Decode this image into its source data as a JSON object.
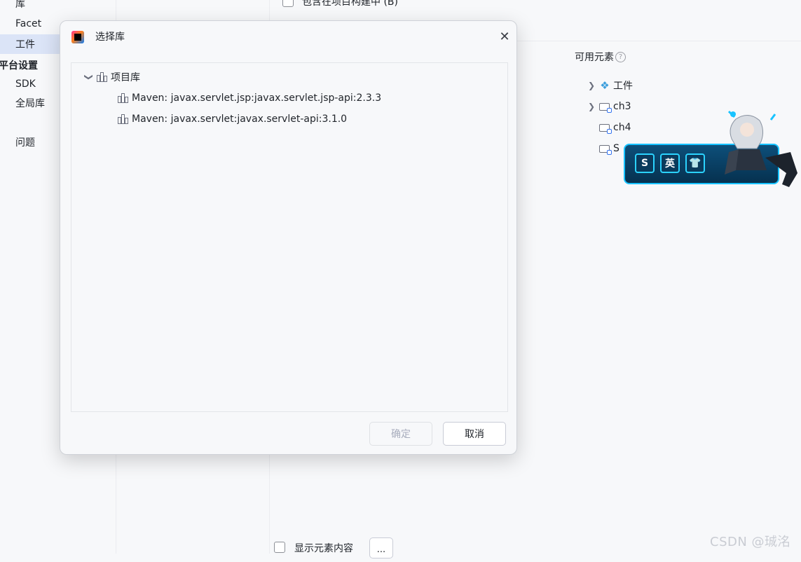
{
  "left_nav": {
    "items_top": [
      "库",
      "Facet",
      "工件"
    ],
    "section_header": "平台设置",
    "items_platform": [
      "SDK",
      "全局库"
    ],
    "problems": "问题"
  },
  "right_pane": {
    "include_in_build_label": "包含在项目构建中 (B)",
    "available_elements_label": "可用元素",
    "tree": [
      {
        "label": "工件",
        "expandable": true,
        "icon": "artifact-icon"
      },
      {
        "label": "ch3",
        "expandable": true,
        "icon": "module-folder-icon"
      },
      {
        "label": "ch4",
        "expandable": false,
        "icon": "module-folder-icon"
      },
      {
        "label": "S",
        "expandable": false,
        "icon": "module-folder-icon"
      }
    ],
    "show_content_label": "显示元素内容",
    "more_button": "..."
  },
  "dialog": {
    "title": "选择库",
    "close_icon": "close-icon",
    "tree_root": "项目库",
    "libraries": [
      "Maven: javax.servlet.jsp:javax.servlet.jsp-api:2.3.3",
      "Maven: javax.servlet:javax.servlet-api:3.1.0"
    ],
    "ok_label": "确定",
    "cancel_label": "取消"
  },
  "ime_widget": {
    "keys": [
      "S",
      "英",
      "👕"
    ]
  },
  "watermark": "CSDN @珹洺",
  "colors": {
    "accent": "#3574f0",
    "selection": "#dbe4f7",
    "background": "#f7f8fa"
  }
}
